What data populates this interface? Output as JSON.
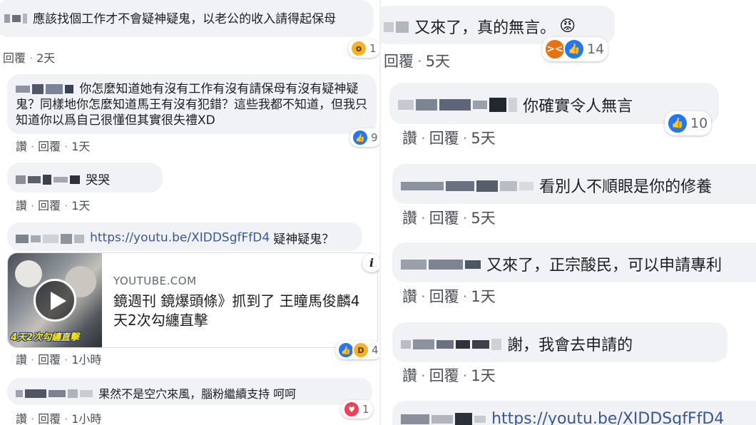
{
  "colors": {
    "like": "#2078f4",
    "love": "#f33e58",
    "angry": "#e9710f",
    "haha": "#f7b125",
    "link": "#385898"
  },
  "left": {
    "c1": {
      "text": "應該找個工作才不會疑神疑鬼，以老公的收入請得起保母",
      "reaction_icon": "wow-reaction-icon",
      "count": "1",
      "reply": "回覆",
      "time": "2天"
    },
    "c2": {
      "text": "你怎麼知道她有沒有工作有沒有請保母有沒有疑神疑鬼？同樣地你怎麼知道馬王有沒有犯錯？這些我都不知道，但我只知道你以爲自己很懂但其實很失禮XD",
      "like": "讚",
      "reply": "回覆",
      "time": "1天",
      "count": "9"
    },
    "c3": {
      "text": "哭哭",
      "like": "讚",
      "reply": "回覆",
      "time": "1天"
    },
    "c4": {
      "link": "https://youtu.be/XIDDSgfFfD4",
      "text": "疑神疑鬼？",
      "preview": {
        "domain": "YOUTUBE.COM",
        "title": "鏡週刊 鏡爆頭條》抓到了 王瞳馬俊麟4天2次勾纏直擊",
        "thumb_caption": "4天2次勾纏直擊",
        "info": "i"
      },
      "like": "讚",
      "reply": "回覆",
      "time": "1小時",
      "count": "4"
    },
    "c5": {
      "text": "果然不是空穴來風，腦粉繼續支持 呵呵",
      "like": "讚",
      "reply": "回覆",
      "time": "1小時",
      "count": "1"
    }
  },
  "right": {
    "c1": {
      "text": "又來了，真的無言。",
      "emoji": "😡",
      "reply": "回覆",
      "time": "5天",
      "count": "14"
    },
    "c2": {
      "text": "你確實令人無言",
      "like": "讚",
      "reply": "回覆",
      "time": "5天",
      "count": "10"
    },
    "c3": {
      "text": "看別人不順眼是你的修養",
      "like": "讚",
      "reply": "回覆",
      "time": "5天"
    },
    "c4": {
      "text": "又來了，正宗酸民，可以申請專利",
      "like": "讚",
      "reply": "回覆",
      "time": "1天"
    },
    "c5": {
      "text": "謝，我會去申請的",
      "like": "讚",
      "reply": "回覆",
      "time": "1天"
    },
    "c6": {
      "link": "https://youtu.be/XIDDSgfFfD4"
    }
  }
}
